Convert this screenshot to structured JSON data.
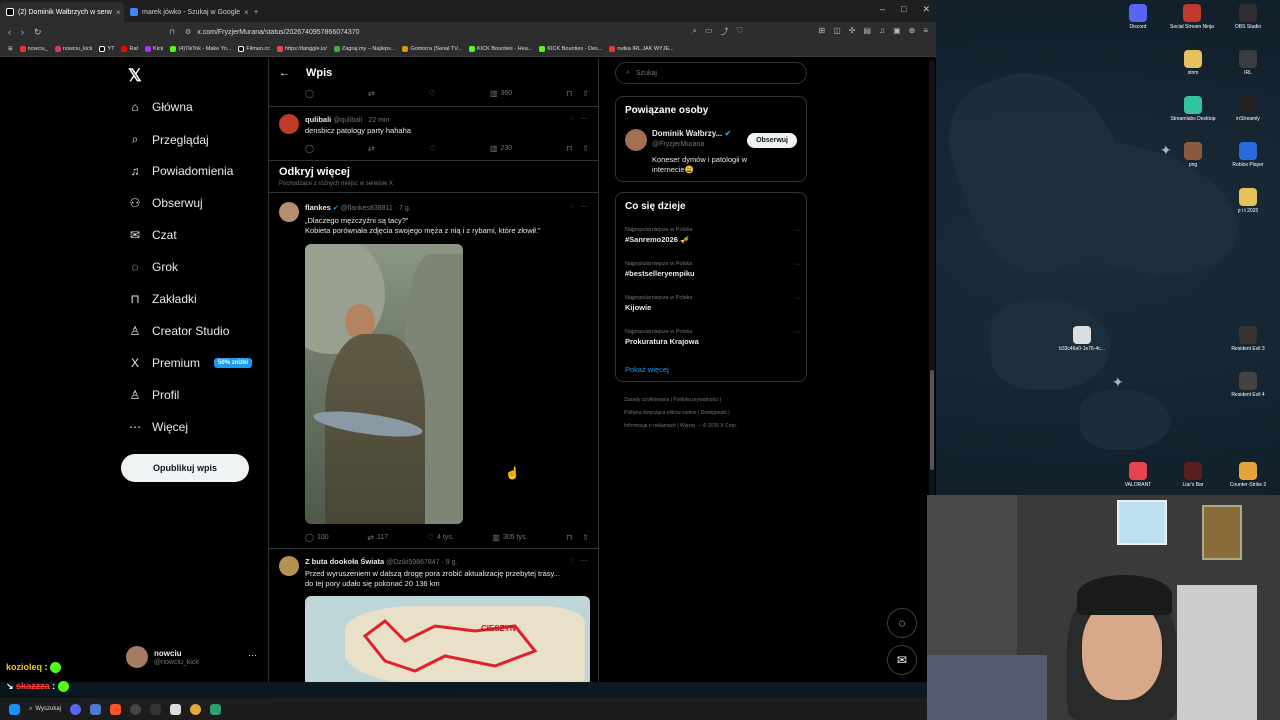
{
  "browser": {
    "tabs": [
      {
        "label": "(2) Dominik Wałbrzych w serw",
        "active": true
      },
      {
        "label": "marek jówko - Szukaj w Google",
        "active": false
      }
    ],
    "new_tab": "+",
    "url": "x.com/FryzjerMurana/status/2026740957866074370",
    "bookmarks": [
      "nowciu_",
      "nowciu_kick",
      "YT",
      "Rat",
      "Kick",
      "(4)TikTok - Make Yo...",
      "Filman.cc",
      "https://tanggle.io/",
      "Zagraj.my – Najleps...",
      "Gomorra (Serial TV...",
      "KICK Bounties - Hea...",
      "KICK Bounties - Des...",
      "nutka IRL JAK WYJE..."
    ]
  },
  "sidebar": {
    "items": [
      {
        "label": "Główna",
        "icon": "home-icon",
        "glyph": "⌂"
      },
      {
        "label": "Przeglądaj",
        "icon": "search-icon",
        "glyph": "⌕"
      },
      {
        "label": "Powiadomienia",
        "icon": "bell-icon",
        "glyph": "♫"
      },
      {
        "label": "Obserwuj",
        "icon": "follow-icon",
        "glyph": "⚇"
      },
      {
        "label": "Czat",
        "icon": "mail-icon",
        "glyph": "✉"
      },
      {
        "label": "Grok",
        "icon": "grok-icon",
        "glyph": "◌"
      },
      {
        "label": "Zakładki",
        "icon": "bookmark-icon",
        "glyph": "⊓"
      },
      {
        "label": "Creator Studio",
        "icon": "creator-icon",
        "glyph": "♙"
      },
      {
        "label": "Premium",
        "icon": "x-icon",
        "glyph": "X"
      },
      {
        "label": "Profil",
        "icon": "profile-icon",
        "glyph": "♙"
      },
      {
        "label": "Więcej",
        "icon": "more-icon",
        "glyph": "⋯"
      }
    ],
    "premium_badge": "50% zniżki",
    "publish_button": "Opublikuj wpis",
    "profile": {
      "name": "nowciu",
      "handle": "@nowciu_kick"
    }
  },
  "feed": {
    "header_title": "Wpis",
    "top_actions": {
      "views": "360"
    },
    "reply1": {
      "author": "qulibali",
      "handle": "@qulibali",
      "time": "· 22 min",
      "text": "densbicz patology party hahaha",
      "views": "230"
    },
    "discover_title": "Odkryj więcej",
    "discover_sub": "Pochodzące z różnych miejsc w serwisie X",
    "tweet1": {
      "author": "flankes",
      "handle": "@flankes838811",
      "time": "· 7 g.",
      "text_line1": "„Dlaczego mężczyźni są tacy?”",
      "text_line2": "Kobieta porównała zdjęcia swojego męża z nią i z rybami, które złowił.”",
      "replies": "100",
      "reposts": "117",
      "likes": "4 tys.",
      "views": "305 tys."
    },
    "tweet2": {
      "author": "Z buta dookoła Świata",
      "handle": "@Dziki59867847",
      "time": "· 9 g.",
      "text": "Przed wyruszeniem w dalszą drogę pora zrobić aktualizację przebytej trasy... do tej pory udało się pokonać 20 136 km",
      "map_label": "CIESZYN"
    }
  },
  "right": {
    "search_placeholder": "Szukaj",
    "related_title": "Powiązane osoby",
    "related_person": {
      "name": "Dominik Wałbrzy...",
      "handle": "@FryzjerMurana",
      "bio": "Koneser dymów i patologii w internecie😩",
      "follow": "Obserwuj"
    },
    "trends_title": "Co się dzieje",
    "trends": [
      {
        "category": "Najpopularniejsze w Polska",
        "name": "#Sanremo2026 🎺"
      },
      {
        "category": "Najpopularniejsze w Polska",
        "name": "#bestselleryempiku"
      },
      {
        "category": "Najpopularniejsze w Polska",
        "name": "Kijowie"
      },
      {
        "category": "Najpopularniejsze w Polska",
        "name": "Prokuratura Krajowa"
      }
    ],
    "show_more": "Pokaż więcej",
    "footer_line1": "Zasady użytkowania   |   Polityka prywatności   |",
    "footer_line2": "Polityka dotycząca plików cookie   |   Dostępność   |",
    "footer_line3": "Informacja o reklamach   |   Więcej ···   © 2026 X Corp."
  },
  "desktop_icons": [
    {
      "label": "Discord",
      "color": "#5865f2"
    },
    {
      "label": "Social Stream Ninja",
      "color": "#c0392b"
    },
    {
      "label": "OBS Studio",
      "color": "#302e31"
    },
    {
      "label": "strim",
      "color": "#e6c25a"
    },
    {
      "label": "IRL",
      "color": "#3d3d3d"
    },
    {
      "label": "Streamlabs Desktop",
      "color": "#31c3a2"
    },
    {
      "label": "inStreamly",
      "color": "#222"
    },
    {
      "label": "png",
      "color": "#8b5a3c"
    },
    {
      "label": "Roblox Player",
      "color": "#2a6be0"
    },
    {
      "label": "p i t 2025",
      "color": "#e6c25a"
    },
    {
      "label": "b33c46e0-1e76-4c...",
      "color": "#ddd"
    },
    {
      "label": "Resident Evil 3",
      "color": "#333"
    },
    {
      "label": "Resident Evil 4",
      "color": "#444"
    },
    {
      "label": "VALORANT",
      "color": "#e84350"
    },
    {
      "label": "Liar's Bar",
      "color": "#5a1f1f"
    },
    {
      "label": "Counter-Strike 2",
      "color": "#e6a33c"
    }
  ],
  "chat": [
    {
      "user": "kozioleq",
      "color": "#f0c419"
    },
    {
      "user": "skazzza",
      "color": "#ff3d3d"
    }
  ],
  "taskbar": {
    "search": "Wyszukaj"
  }
}
